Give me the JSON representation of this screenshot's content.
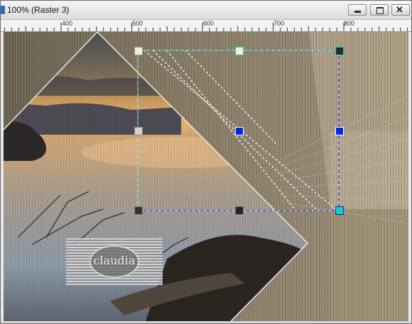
{
  "window": {
    "title": "100% (Raster 3)"
  },
  "titlebar": {
    "buttons": [
      "minimize-icon",
      "maximize-icon",
      "close-icon"
    ],
    "close_glyph": "✕"
  },
  "ruler": {
    "labels": [
      "400",
      "500",
      "600",
      "700",
      "800"
    ],
    "units": "px"
  },
  "watermark": {
    "text": "claudia"
  },
  "colors": {
    "selection_handle": "#0026e6",
    "dashed_line": "#1a1aff",
    "accent_cyan": "#18d0c0",
    "taupe": "#8e8068"
  }
}
